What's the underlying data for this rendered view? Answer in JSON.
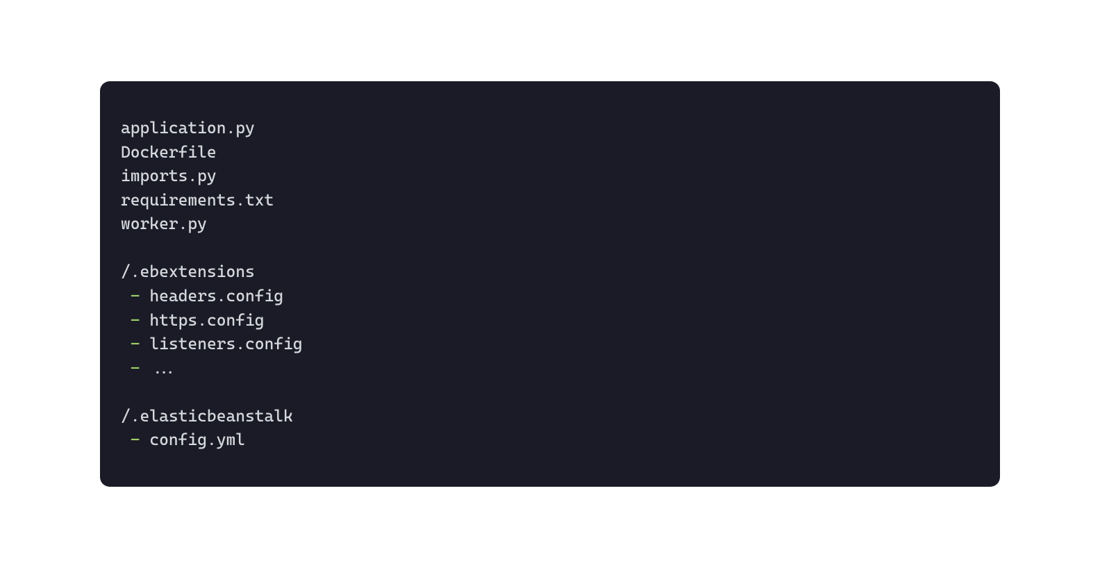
{
  "code": {
    "colors": {
      "background": "#1a1b26",
      "text": "#d5d8dd",
      "dash": "#9ece6a"
    },
    "lines": [
      {
        "type": "plain",
        "text": "application.py"
      },
      {
        "type": "plain",
        "text": "Dockerfile"
      },
      {
        "type": "plain",
        "text": "imports.py"
      },
      {
        "type": "plain",
        "text": "requirements.txt"
      },
      {
        "type": "plain",
        "text": "worker.py"
      },
      {
        "type": "blank"
      },
      {
        "type": "plain",
        "text": "/.ebextensions"
      },
      {
        "type": "list-item",
        "text": "headers.config"
      },
      {
        "type": "list-item",
        "text": "https.config"
      },
      {
        "type": "list-item",
        "text": "listeners.config"
      },
      {
        "type": "list-item",
        "text": "..."
      },
      {
        "type": "blank"
      },
      {
        "type": "plain",
        "text": "/.elasticbeanstalk"
      },
      {
        "type": "list-item",
        "text": "config.yml"
      }
    ]
  }
}
